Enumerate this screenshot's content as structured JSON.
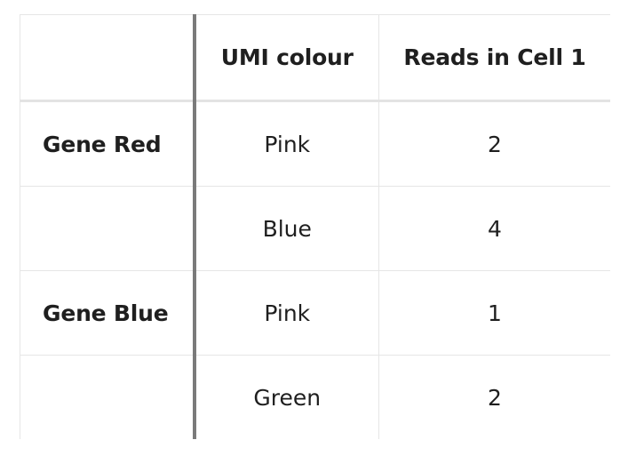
{
  "table": {
    "headers": [
      "",
      "UMI colour",
      "Reads in Cell 1"
    ],
    "rows": [
      {
        "gene": "Gene Red",
        "umi": "Pink",
        "reads": "2"
      },
      {
        "gene": "",
        "umi": "Blue",
        "reads": "4"
      },
      {
        "gene": "Gene Blue",
        "umi": "Pink",
        "reads": "1"
      },
      {
        "gene": "",
        "umi": "Green",
        "reads": "2"
      }
    ]
  }
}
